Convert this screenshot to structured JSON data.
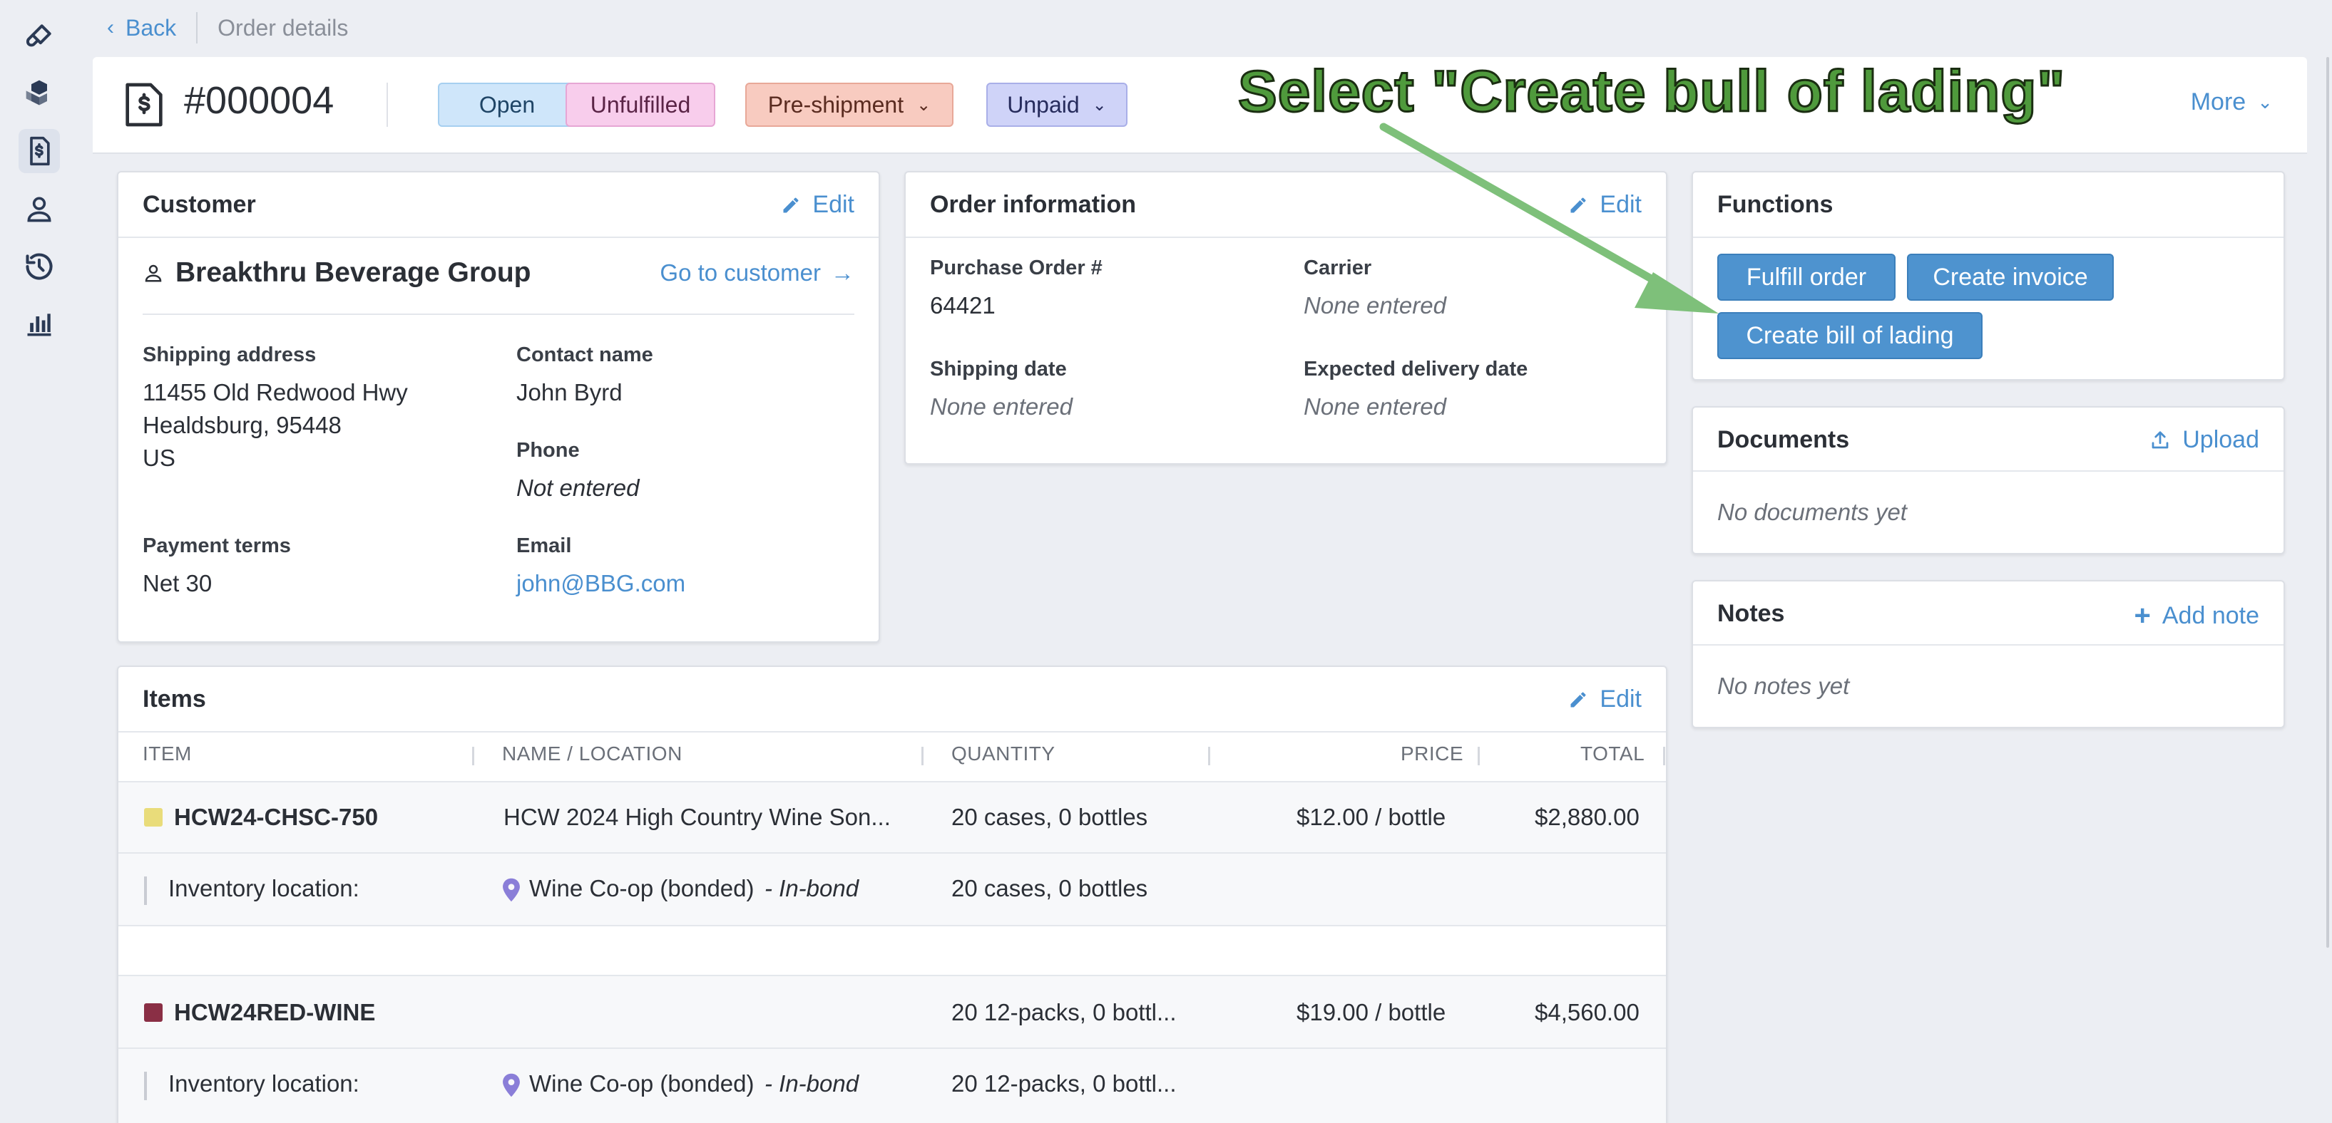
{
  "rail": {
    "items": [
      {
        "icon": "paintbrush-icon"
      },
      {
        "icon": "boxes-icon"
      },
      {
        "icon": "order-document-icon",
        "active": true
      },
      {
        "icon": "person-icon"
      },
      {
        "icon": "history-icon"
      },
      {
        "icon": "bar-chart-icon"
      }
    ]
  },
  "breadcrumb": {
    "back": "Back",
    "current": "Order details"
  },
  "order": {
    "number": "#000004",
    "badges": {
      "open": "Open",
      "fulfillment": "Unfulfilled",
      "shipment": "Pre-shipment",
      "payment": "Unpaid"
    },
    "more": "More"
  },
  "customer": {
    "title": "Customer",
    "edit": "Edit",
    "name": "Breakthru Beverage Group",
    "go_to": "Go to customer",
    "shipping_label": "Shipping address",
    "address_line1": "11455 Old Redwood Hwy",
    "address_line2": "Healdsburg, 95448",
    "address_line3": "US",
    "contact_label": "Contact name",
    "contact_value": "John Byrd",
    "phone_label": "Phone",
    "phone_value": "Not entered",
    "payment_label": "Payment terms",
    "payment_value": "Net 30",
    "email_label": "Email",
    "email_value": "john@BBG.com"
  },
  "order_info": {
    "title": "Order information",
    "edit": "Edit",
    "po_label": "Purchase Order #",
    "po_value": "64421",
    "carrier_label": "Carrier",
    "carrier_value": "None entered",
    "ship_label": "Shipping date",
    "ship_value": "None entered",
    "delivery_label": "Expected delivery date",
    "delivery_value": "None entered"
  },
  "functions": {
    "title": "Functions",
    "fulfill": "Fulfill order",
    "invoice": "Create invoice",
    "bol": "Create bill of lading"
  },
  "documents": {
    "title": "Documents",
    "upload": "Upload",
    "empty": "No documents yet"
  },
  "notes": {
    "title": "Notes",
    "add": "Add note",
    "empty": "No notes yet"
  },
  "items": {
    "title": "Items",
    "edit": "Edit",
    "columns": [
      "ITEM",
      "NAME / LOCATION",
      "QUANTITY",
      "PRICE",
      "TOTAL"
    ],
    "rows": [
      {
        "sku": "HCW24-CHSC-750",
        "swatch": "#e9dc7a",
        "name": "HCW 2024 High Country Wine Son...",
        "quantity": "20 cases, 0 bottles",
        "price": "$12.00 / bottle",
        "total": "$2,880.00",
        "loc_label": "Inventory location:",
        "loc_name": "Wine Co-op (bonded)",
        "loc_tag": "- In-bond",
        "loc_qty": "20 cases, 0 bottles"
      },
      {
        "sku": "HCW24RED-WINE",
        "swatch": "#8a2f45",
        "name": "",
        "quantity": "20 12-packs, 0 bottl...",
        "price": "$19.00 / bottle",
        "total": "$4,560.00",
        "loc_label": "Inventory location:",
        "loc_name": "Wine Co-op (bonded)",
        "loc_tag": "- In-bond",
        "loc_qty": "20 12-packs, 0 bottl..."
      }
    ]
  },
  "annotation": {
    "text": "Select \"Create bull of lading\"",
    "color": "#4f9a3c"
  },
  "colors": {
    "accent": "#4a8fcf",
    "button": "#4e93cf"
  }
}
